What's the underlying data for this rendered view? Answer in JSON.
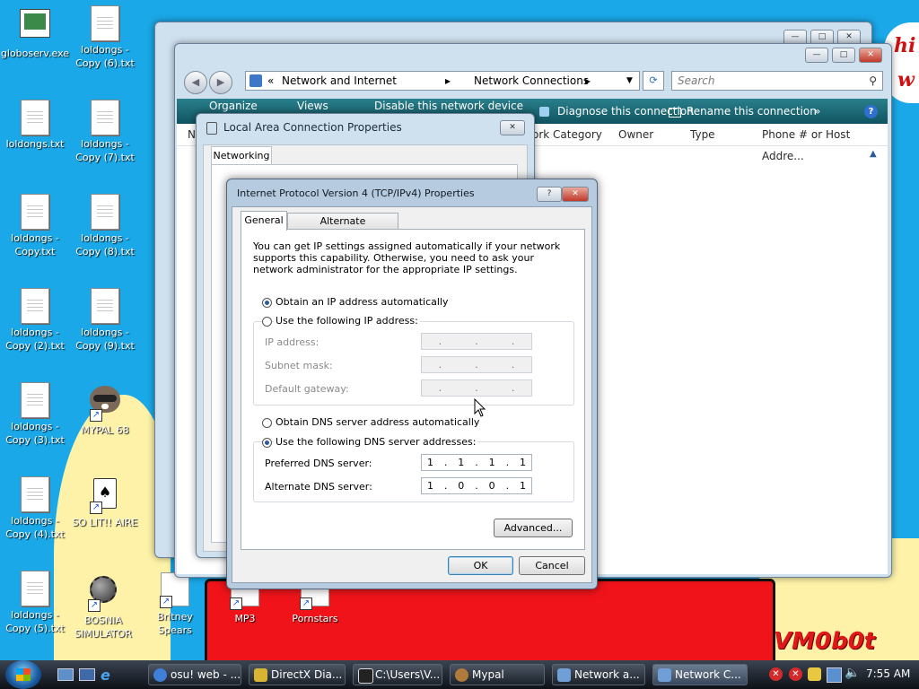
{
  "desktop": {
    "icons": [
      {
        "label": "globoserv.exe"
      },
      {
        "label": "loldongs - Copy (6).txt"
      },
      {
        "label": "loldongs.txt"
      },
      {
        "label": "loldongs - Copy (7).txt"
      },
      {
        "label": "loldongs - Copy.txt"
      },
      {
        "label": "loldongs - Copy (8).txt"
      },
      {
        "label": "loldongs - Copy (2).txt"
      },
      {
        "label": "loldongs - Copy (9).txt"
      },
      {
        "label": "loldongs - Copy (3).txt"
      },
      {
        "label": "MYPAL 68"
      },
      {
        "label": "loldongs - Copy (4).txt"
      },
      {
        "label": "SO LIT!! AIRE"
      },
      {
        "label": "loldongs - Copy (5).txt"
      },
      {
        "label": "BOSNIA SIMULATOR"
      },
      {
        "label": "Britney Spears"
      },
      {
        "label": "MP3"
      },
      {
        "label": "Pornstars"
      }
    ],
    "wallpaper_signature": "VM0b0t",
    "wallpaper_text_fragments": [
      "hi",
      "w"
    ]
  },
  "explorer": {
    "address_segments": [
      "Network and Internet",
      "Network Connections"
    ],
    "search_placeholder": "Search",
    "toolbar": {
      "organize": "Organize",
      "views": "Views",
      "disable": "Disable this network device",
      "diagnose": "Diagnose this connection",
      "rename": "Rename this connection",
      "more": "»"
    },
    "columns": [
      "N",
      "ork Category",
      "Owner",
      "Type",
      "Phone # or Host Addre..."
    ]
  },
  "lac_dialog": {
    "title": "Local Area Connection Properties",
    "tab": "Networking"
  },
  "ipv4_dialog": {
    "title": "Internet Protocol Version 4 (TCP/IPv4) Properties",
    "tabs": [
      "General",
      "Alternate Configuration"
    ],
    "description": "You can get IP settings assigned automatically if your network supports this capability. Otherwise, you need to ask your network administrator for the appropriate IP settings.",
    "obtain_ip_auto": "Obtain an IP address automatically",
    "use_following_ip": "Use the following IP address:",
    "ip_address_label": "IP address:",
    "subnet_mask_label": "Subnet mask:",
    "gateway_label": "Default gateway:",
    "obtain_dns_auto": "Obtain DNS server address automatically",
    "use_following_dns": "Use the following DNS server addresses:",
    "preferred_dns_label": "Preferred DNS server:",
    "alternate_dns_label": "Alternate DNS server:",
    "preferred_dns": [
      "1",
      "1",
      "1",
      "1"
    ],
    "alternate_dns": [
      "1",
      "0",
      "0",
      "1"
    ],
    "selected_ip_option": "automatic",
    "selected_dns_option": "manual",
    "advanced": "Advanced...",
    "ok": "OK",
    "cancel": "Cancel",
    "help_glyph": "?",
    "close_glyph": "✕"
  },
  "taskbar": {
    "tasks": [
      {
        "label": "osu! web - ...",
        "color": "#3f7fd8"
      },
      {
        "label": "DirectX Dia...",
        "color": "#d8b432"
      },
      {
        "label": "C:\\Users\\V...",
        "color": "#e6e6e6"
      },
      {
        "label": "Mypal",
        "color": "#b07a3a"
      },
      {
        "label": "Network a...",
        "color": "#6f9fd6"
      },
      {
        "label": "Network C...",
        "color": "#6f9fd6"
      }
    ],
    "active_task": "Network C...",
    "clock": "7:55 AM"
  },
  "colors": {
    "desktop": "#1aa8e8",
    "toolbar": "#15606e",
    "accent": "#2d5a9a"
  }
}
